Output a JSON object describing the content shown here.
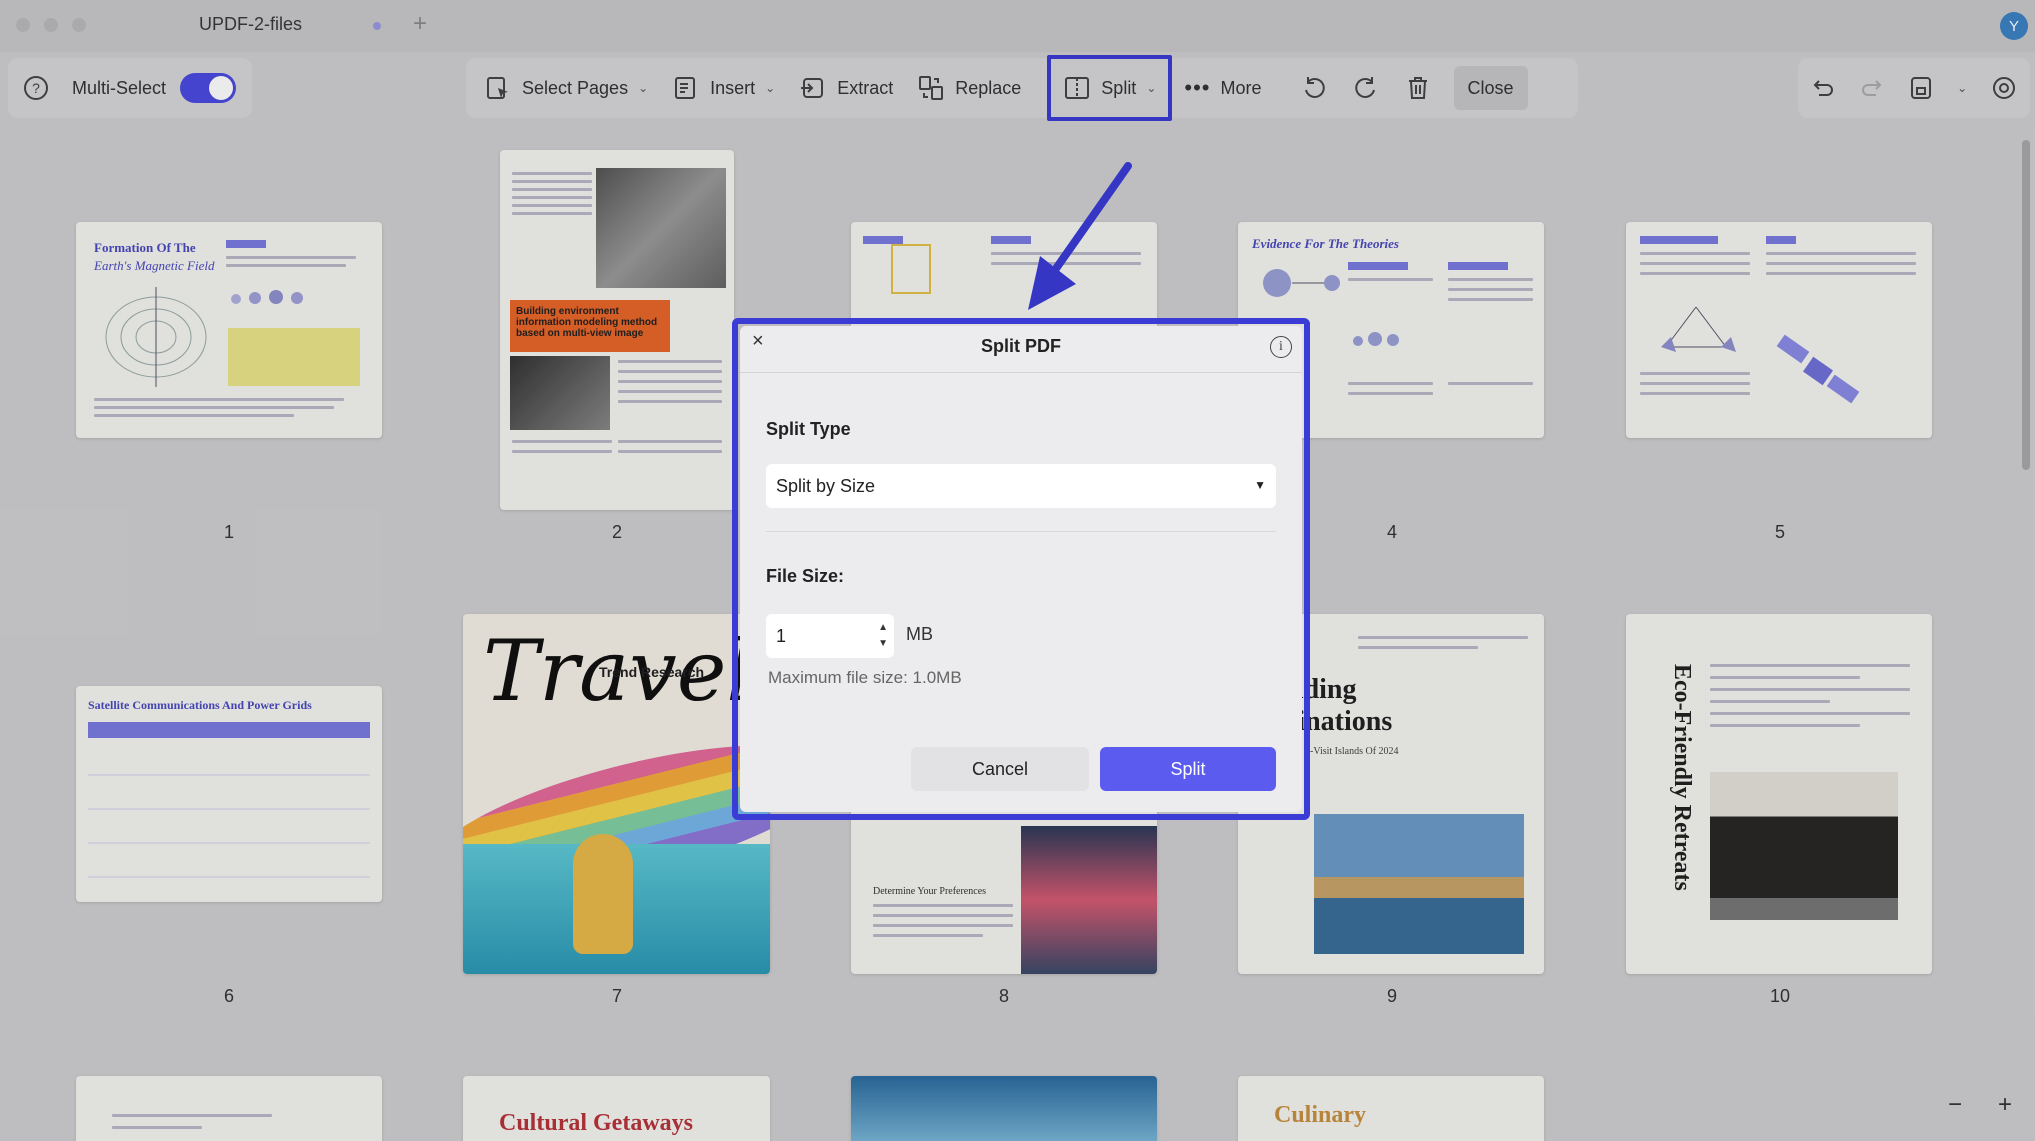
{
  "window": {
    "tab_title": "UPDF-2-files",
    "user_initial": "Y"
  },
  "left_toolbar": {
    "multi_select_label": "Multi-Select",
    "multi_select_on": true
  },
  "toolbar": {
    "select_pages": "Select Pages",
    "insert": "Insert",
    "extract": "Extract",
    "replace": "Replace",
    "split": "Split",
    "more": "More",
    "close": "Close"
  },
  "pages": {
    "numbers": [
      "1",
      "2",
      "4",
      "5",
      "6",
      "7",
      "8",
      "9",
      "10"
    ],
    "p1_title": "Formation Of The",
    "p1_subtitle": "Earth's Magnetic Field",
    "p2_banner": "Building environment information modeling method based on multi-view image",
    "p4_title": "Evidence For The Theories",
    "p6_title": "Satellite Communications And Power Grids",
    "p7_script": "Travel",
    "p7_label": "Trend Research",
    "p8_heading": "Determine Your Preferences",
    "p9_heading_1": "nding",
    "p9_heading_2": "tinations",
    "p9_sub": "-Visit Islands Of 2024",
    "p10_vertical": "Eco-Friendly Retreats",
    "row3_p2": "Cultural Getaways",
    "row3_p4": "Culinary"
  },
  "dialog": {
    "title": "Split PDF",
    "split_type_label": "Split Type",
    "split_type_value": "Split by Size",
    "file_size_label": "File Size:",
    "file_size_value": "1",
    "unit": "MB",
    "max_file_size": "Maximum file size: 1.0MB",
    "cancel": "Cancel",
    "split": "Split"
  },
  "colors": {
    "accent": "#5b5bf0",
    "highlight": "#3b3bd6"
  }
}
